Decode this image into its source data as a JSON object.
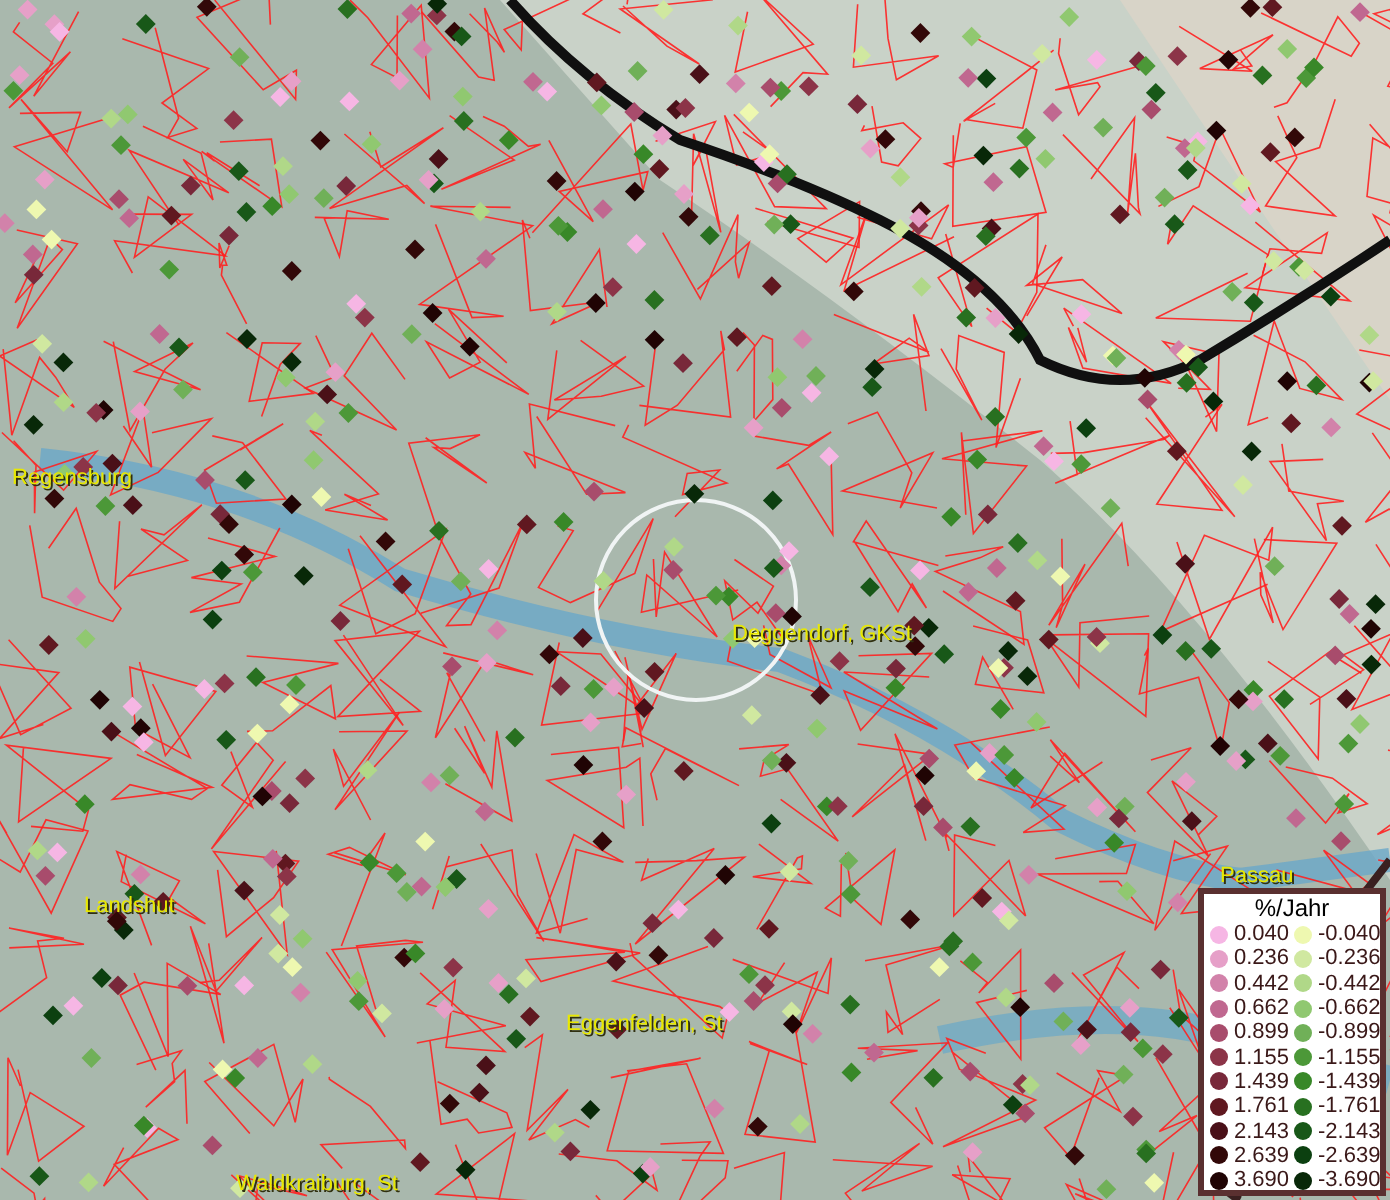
{
  "places": [
    {
      "label": "Regensburg"
    },
    {
      "label": "Deggendorf, GKSt"
    },
    {
      "label": "Passau"
    },
    {
      "label": "Landshut"
    },
    {
      "label": "Eggenfelden, St"
    },
    {
      "label": "Waldkraiburg, St"
    }
  ],
  "legend": {
    "title": "%/Jahr",
    "positive": [
      {
        "label": "0.040",
        "color": "#f6b6e4"
      },
      {
        "label": "0.236",
        "color": "#e6a0c8"
      },
      {
        "label": "0.442",
        "color": "#d282aa"
      },
      {
        "label": "0.662",
        "color": "#c06890"
      },
      {
        "label": "0.899",
        "color": "#a84c6c"
      },
      {
        "label": "1.155",
        "color": "#8c3448"
      },
      {
        "label": "1.439",
        "color": "#78283a"
      },
      {
        "label": "1.761",
        "color": "#601820"
      },
      {
        "label": "2.143",
        "color": "#4a1018"
      },
      {
        "label": "2.639",
        "color": "#320808"
      },
      {
        "label": "3.690",
        "color": "#200404"
      }
    ],
    "negative": [
      {
        "label": "-0.040",
        "color": "#eef8b0"
      },
      {
        "label": "-0.236",
        "color": "#d0e8a0"
      },
      {
        "label": "-0.442",
        "color": "#b0d888"
      },
      {
        "label": "-0.662",
        "color": "#90c870"
      },
      {
        "label": "-0.899",
        "color": "#70b058"
      },
      {
        "label": "-1.155",
        "color": "#4c9838"
      },
      {
        "label": "-1.439",
        "color": "#388828"
      },
      {
        "label": "-1.761",
        "color": "#287020"
      },
      {
        "label": "-2.143",
        "color": "#185818"
      },
      {
        "label": "-2.639",
        "color": "#0c4010"
      },
      {
        "label": "-3.690",
        "color": "#082808"
      }
    ]
  }
}
